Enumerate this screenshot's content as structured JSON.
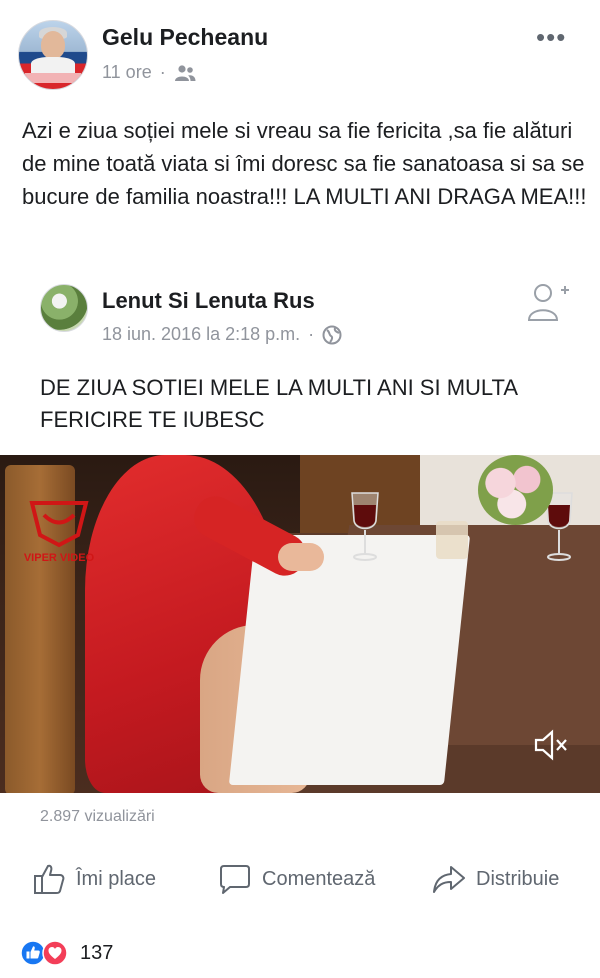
{
  "post": {
    "author": "Gelu Pecheanu",
    "time": "11 ore",
    "separator": "·",
    "audience_icon": "friends-icon",
    "more_label": "•••",
    "text": "Azi e ziua soției mele  si vreau sa fie fericita ,sa fie alături de mine toată viata si îmi doresc sa fie sanatoasa si sa se bucure de familia noastra!!! LA MULTI ANI DRAGA MEA!!!"
  },
  "shared": {
    "author": "Lenut Si Lenuta Rus",
    "time": "18 iun. 2016 la 2:18 p.m.",
    "separator": "·",
    "audience_icon": "globe-icon",
    "text": "DE ZIUA SOTIEI MELE LA MULTI ANI SI MULTA FERICIRE TE IUBESC"
  },
  "video": {
    "watermark": "VIPER VIDEO",
    "views": "2.897 vizualizări"
  },
  "actions": {
    "like": "Îmi place",
    "comment": "Comentează",
    "share": "Distribuie"
  },
  "reactions": {
    "count": "137"
  },
  "colors": {
    "text": "#1c1e21",
    "meta": "#90949c",
    "like_blue": "#1877f2",
    "love_red": "#f33e58"
  }
}
